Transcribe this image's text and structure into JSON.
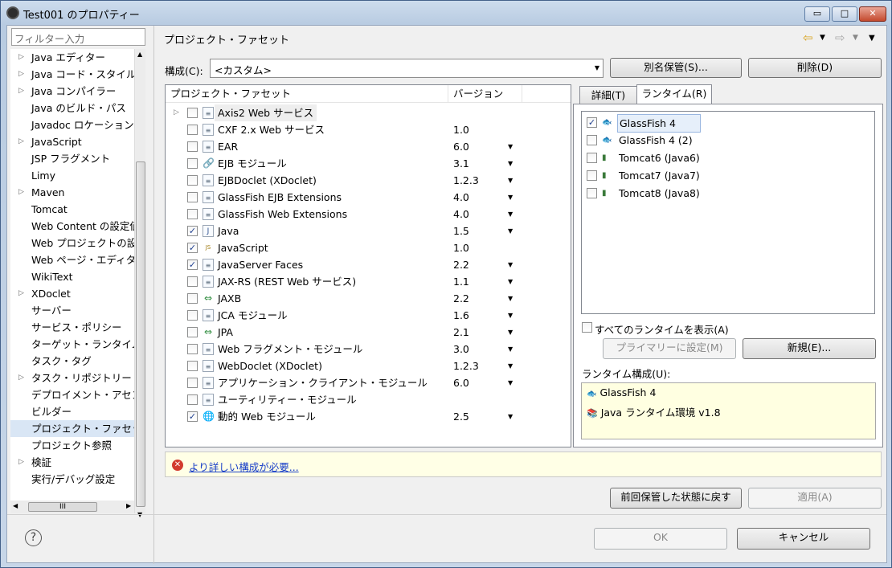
{
  "window": {
    "title": "Test001 のプロパティー"
  },
  "filter": {
    "placeholder": "フィルター入力"
  },
  "tree": [
    "Java エディター",
    "Java コード・スタイル",
    "Java コンパイラー",
    "Java のビルド・パス",
    "Javadoc ロケーション",
    "JavaScript",
    "JSP フラグメント",
    "Limy",
    "Maven",
    "Tomcat",
    "Web Content の設定値",
    "Web プロジェクトの設",
    "Web ページ・エディタ",
    "WikiText",
    "XDoclet",
    "サーバー",
    "サービス・ポリシー",
    "ターゲット・ランタイム",
    "タスク・タグ",
    "タスク・リポジトリー",
    "デプロイメント・アセン",
    "ビルダー",
    "プロジェクト・ファセッ",
    "プロジェクト参照",
    "検証",
    "実行/デバッグ設定"
  ],
  "page": {
    "title": "プロジェクト・ファセット",
    "config_label": "構成(C):",
    "config_value": "<カスタム>",
    "save_as": "別名保管(S)...",
    "delete": "削除(D)"
  },
  "facets": {
    "col_facet": "プロジェクト・ファセット",
    "col_version": "バージョン",
    "rows": [
      {
        "name": "Axis2 Web サービス",
        "version": "",
        "checked": false,
        "icon": "doc",
        "dd": false
      },
      {
        "name": "CXF 2.x Web サービス",
        "version": "1.0",
        "checked": false,
        "icon": "doc",
        "dd": false
      },
      {
        "name": "EAR",
        "version": "6.0",
        "checked": false,
        "icon": "doc",
        "dd": true
      },
      {
        "name": "EJB モジュール",
        "version": "3.1",
        "checked": false,
        "icon": "ejb",
        "dd": true
      },
      {
        "name": "EJBDoclet (XDoclet)",
        "version": "1.2.3",
        "checked": false,
        "icon": "doc",
        "dd": true
      },
      {
        "name": "GlassFish EJB Extensions",
        "version": "4.0",
        "checked": false,
        "icon": "doc",
        "dd": true
      },
      {
        "name": "GlassFish Web Extensions",
        "version": "4.0",
        "checked": false,
        "icon": "doc",
        "dd": true
      },
      {
        "name": "Java",
        "version": "1.5",
        "checked": true,
        "icon": "java",
        "dd": true
      },
      {
        "name": "JavaScript",
        "version": "1.0",
        "checked": true,
        "icon": "js",
        "dd": false
      },
      {
        "name": "JavaServer Faces",
        "version": "2.2",
        "checked": true,
        "icon": "doc",
        "dd": true
      },
      {
        "name": "JAX-RS (REST Web サービス)",
        "version": "1.1",
        "checked": false,
        "icon": "doc",
        "dd": true
      },
      {
        "name": "JAXB",
        "version": "2.2",
        "checked": false,
        "icon": "arrows",
        "dd": true
      },
      {
        "name": "JCA モジュール",
        "version": "1.6",
        "checked": false,
        "icon": "doc",
        "dd": true
      },
      {
        "name": "JPA",
        "version": "2.1",
        "checked": false,
        "icon": "arrows",
        "dd": true
      },
      {
        "name": "Web フラグメント・モジュール",
        "version": "3.0",
        "checked": false,
        "icon": "doc",
        "dd": true
      },
      {
        "name": "WebDoclet (XDoclet)",
        "version": "1.2.3",
        "checked": false,
        "icon": "doc",
        "dd": true
      },
      {
        "name": "アプリケーション・クライアント・モジュール",
        "version": "6.0",
        "checked": false,
        "icon": "doc",
        "dd": true
      },
      {
        "name": "ユーティリティー・モジュール",
        "version": "",
        "checked": false,
        "icon": "doc",
        "dd": false
      },
      {
        "name": "動的 Web モジュール",
        "version": "2.5",
        "checked": true,
        "icon": "web",
        "dd": true
      }
    ]
  },
  "tabs": {
    "details": "詳細(T)",
    "runtimes": "ランタイム(R)"
  },
  "runtimes": [
    {
      "name": "GlassFish 4",
      "checked": true
    },
    {
      "name": "GlassFish 4 (2)",
      "checked": false
    },
    {
      "name": "Tomcat6 (Java6)",
      "checked": false
    },
    {
      "name": "Tomcat7 (Java7)",
      "checked": false
    },
    {
      "name": "Tomcat8 (Java8)",
      "checked": false
    }
  ],
  "show_all": "すべてのランタイムを表示(A)",
  "primary_btn": "プライマリーに設定(M)",
  "new_btn": "新規(E)...",
  "runtime_cfg_label": "ランタイム構成(U):",
  "runtime_cfg": [
    "GlassFish 4",
    "Java ランタイム環境 v1.8"
  ],
  "error_link": "より詳しい構成が必要...",
  "restore_btn": "前回保管した状態に戻す",
  "apply_btn": "適用(A)",
  "ok_btn": "OK",
  "cancel_btn": "キャンセル"
}
